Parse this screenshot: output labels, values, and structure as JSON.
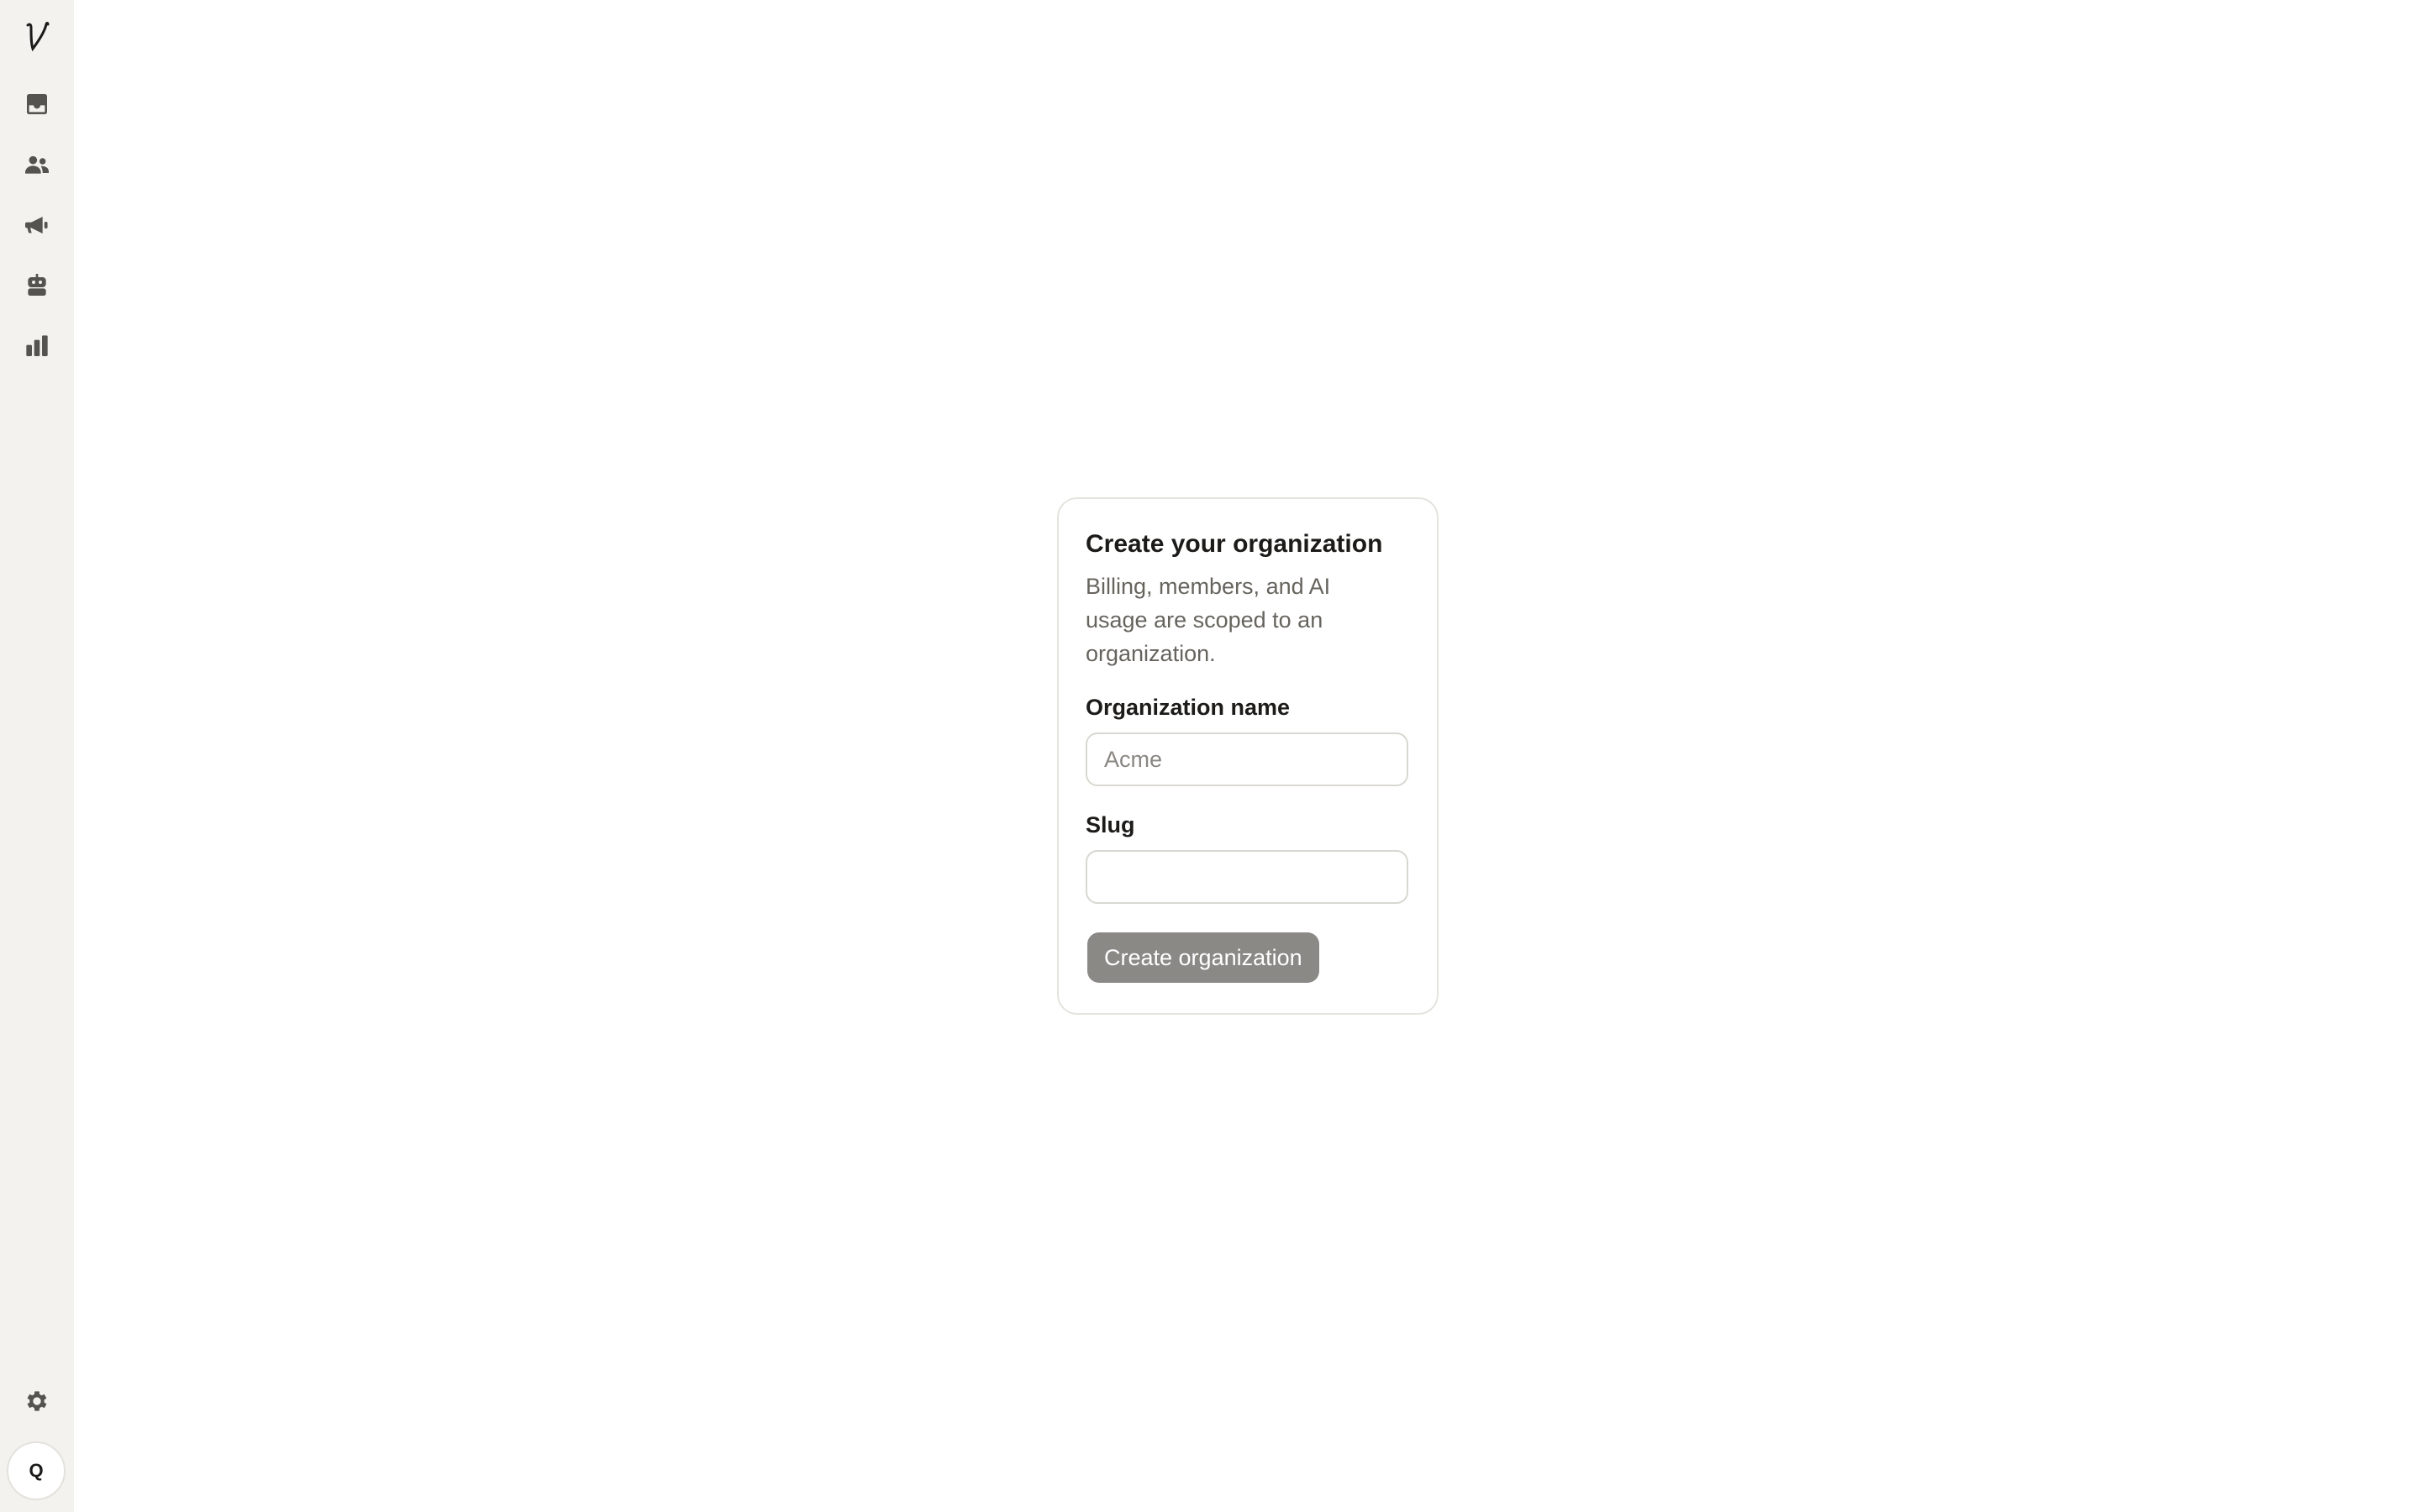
{
  "sidebar": {
    "logo_icon": "brand-logo-v",
    "items": [
      {
        "name": "inbox",
        "icon": "inbox-icon"
      },
      {
        "name": "contacts",
        "icon": "users-icon"
      },
      {
        "name": "campaigns",
        "icon": "megaphone-icon"
      },
      {
        "name": "agents",
        "icon": "robot-icon"
      },
      {
        "name": "reports",
        "icon": "bar-chart-icon"
      }
    ],
    "settings_icon": "gear-icon",
    "avatar_initial": "Q"
  },
  "card": {
    "title": "Create your organization",
    "description": "Billing, members, and AI usage are scoped to an organization.",
    "org_name_label": "Organization name",
    "org_name_placeholder": "Acme",
    "org_name_value": "",
    "slug_label": "Slug",
    "slug_placeholder": "",
    "slug_value": "",
    "submit_label": "Create organization"
  },
  "colors": {
    "sidebar_bg": "#f3f2ee",
    "icon": "#55534f",
    "button_disabled": "#8a8986",
    "card_border": "#e6e4df",
    "muted_text": "#67645e"
  }
}
